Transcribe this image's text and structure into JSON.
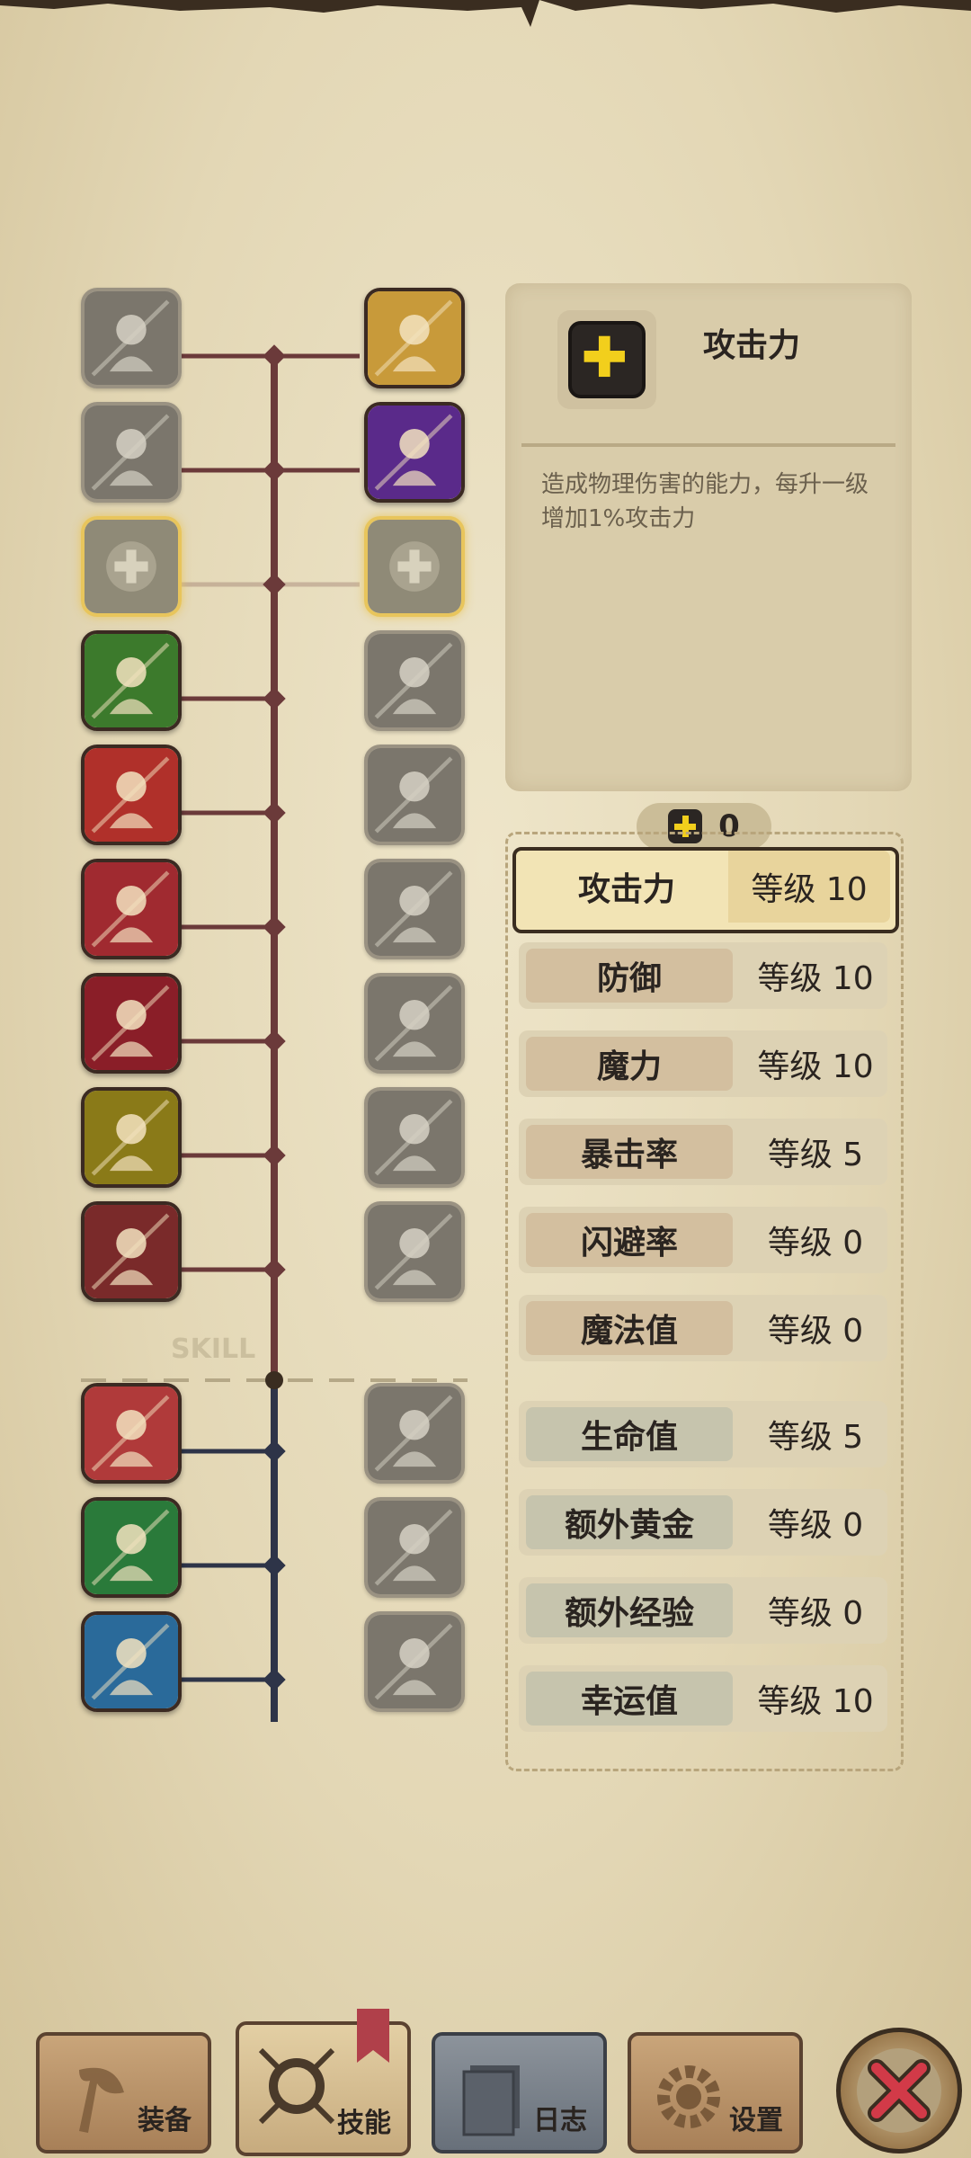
{
  "colors": {
    "accent_yellow": "#f2cf1c",
    "selected_border": "#e8c55c",
    "panel_bg": "#d9ccaa",
    "line_red": "#6b3a3a",
    "line_blue": "#2e3448"
  },
  "tree": {
    "divider_text": "SKILL",
    "left_skills": [
      {
        "icon": "slash-icon",
        "state": "locked"
      },
      {
        "icon": "dash-strike-icon",
        "state": "locked"
      },
      {
        "icon": "attack-up-icon",
        "state": "selected"
      },
      {
        "icon": "strength-arm-icon",
        "state": "unlocked"
      },
      {
        "icon": "spin-strike-icon",
        "state": "unlocked"
      },
      {
        "icon": "dagger-icon",
        "state": "unlocked"
      },
      {
        "icon": "ninja-icon",
        "state": "unlocked"
      },
      {
        "icon": "golden-armor-icon",
        "state": "unlocked"
      },
      {
        "icon": "sword-icon",
        "state": "unlocked"
      },
      {
        "icon": "treasure-drop-icon",
        "state": "unlocked"
      },
      {
        "icon": "hand-chest-icon",
        "state": "unlocked"
      },
      {
        "icon": "blue-aura-icon",
        "state": "unlocked"
      }
    ],
    "right_skills": [
      {
        "icon": "shield-cross-icon",
        "state": "unlocked"
      },
      {
        "icon": "purple-slash-icon",
        "state": "unlocked"
      },
      {
        "icon": "attack-up-locked-icon",
        "state": "selected"
      },
      {
        "icon": "rush-icon",
        "state": "locked"
      },
      {
        "icon": "smoke-icon",
        "state": "locked"
      },
      {
        "icon": "eye-burst-icon",
        "state": "locked"
      },
      {
        "icon": "fish-icon",
        "state": "locked"
      },
      {
        "icon": "gear-blast-icon",
        "state": "locked"
      },
      {
        "icon": "sparkle-figure-icon",
        "state": "locked"
      },
      {
        "icon": "eye-chest-icon",
        "state": "locked"
      },
      {
        "icon": "eye-chest-2-icon",
        "state": "locked"
      },
      {
        "icon": "question-figure-icon",
        "state": "locked"
      }
    ]
  },
  "info": {
    "icon": "plus-icon",
    "title": "攻击力",
    "description": "造成物理伤害的能力，每升一级增加1%攻击力"
  },
  "points": {
    "icon": "plus-icon",
    "value": "0"
  },
  "attributes": [
    {
      "name": "攻击力",
      "level": "等级 10",
      "group": "red",
      "active": true
    },
    {
      "name": "防御",
      "level": "等级 10",
      "group": "red",
      "active": false
    },
    {
      "name": "魔力",
      "level": "等级 10",
      "group": "red",
      "active": false
    },
    {
      "name": "暴击率",
      "level": "等级 5",
      "group": "red",
      "active": false
    },
    {
      "name": "闪避率",
      "level": "等级 0",
      "group": "red",
      "active": false
    },
    {
      "name": "魔法值",
      "level": "等级 0",
      "group": "red",
      "active": false
    },
    {
      "name": "生命值",
      "level": "等级 5",
      "group": "green",
      "active": false
    },
    {
      "name": "额外黄金",
      "level": "等级 0",
      "group": "green",
      "active": false
    },
    {
      "name": "额外经验",
      "level": "等级 0",
      "group": "green",
      "active": false
    },
    {
      "name": "幸运值",
      "level": "等级 10",
      "group": "green",
      "active": false
    }
  ],
  "tabs": [
    {
      "label": "装备",
      "icon": "axe-icon"
    },
    {
      "label": "技能",
      "icon": "skill-ring-icon",
      "active": true
    },
    {
      "label": "日志",
      "icon": "book-icon"
    },
    {
      "label": "设置",
      "icon": "gear-icon"
    }
  ],
  "close": {
    "icon": "close-icon"
  }
}
